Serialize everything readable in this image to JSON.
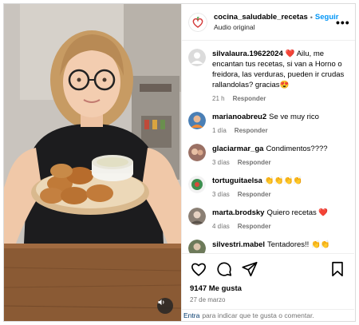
{
  "header": {
    "username": "cocina_saludable_recetas",
    "separator": "•",
    "follow_label": "Seguir",
    "audio_label": "Audio original",
    "more_label": "•••"
  },
  "comments": [
    {
      "user": "silvalaura.19622024",
      "text": "❤️ Ailu, me encantan tus recetas, si van a Horno o freidora, las verduras, pueden ir crudas rallandolas? gracias😍",
      "time": "21 h",
      "reply": "Responder",
      "avatar_color": "#c7c7c7"
    },
    {
      "user": "marianoabreu2",
      "text": "Se ve muy rico",
      "time": "1 día",
      "reply": "Responder",
      "avatar_color": "#4a7fb5"
    },
    {
      "user": "glaciarmar_ga",
      "text": "Condimentos????",
      "time": "3 días",
      "reply": "Responder",
      "avatar_color": "#b07b6a"
    },
    {
      "user": "tortuguitaelsa",
      "text": "👏👏👏👏",
      "time": "3 días",
      "reply": "Responder",
      "avatar_color": "#3e8f4f"
    },
    {
      "user": "marta.brodsky",
      "text": "Quiero recetas ❤️",
      "time": "4 días",
      "reply": "Responder",
      "avatar_color": "#8a7f74"
    },
    {
      "user": "silvestri.mabel",
      "text": "Tentadores!! 👏👏",
      "time": "",
      "reply": "",
      "avatar_color": "#6d7a5a"
    }
  ],
  "actions": {
    "likes": "9147 Me gusta",
    "date": "27 de marzo"
  },
  "footer": {
    "link": "Entra",
    "text": "para indicar que te gusta o comentar."
  },
  "colors": {
    "follow": "#0095f6",
    "heart": "#e0245e",
    "muted": "#737373"
  }
}
